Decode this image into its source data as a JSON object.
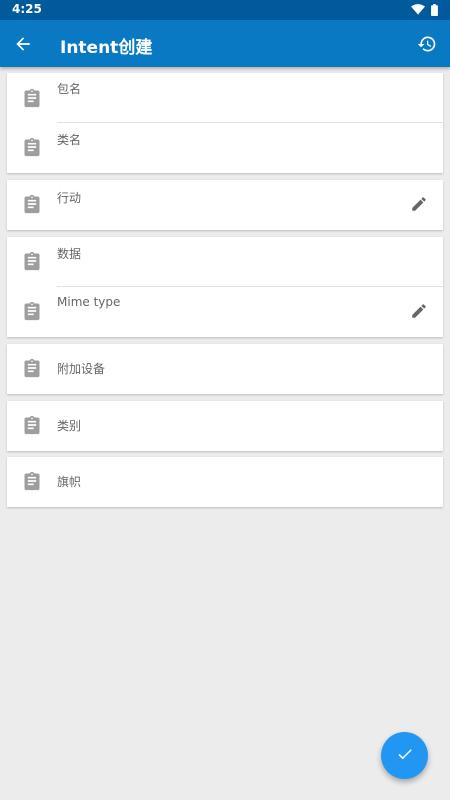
{
  "status_bar": {
    "time": "4:25",
    "icons": [
      "wifi-icon",
      "battery-icon"
    ]
  },
  "app_bar": {
    "title": "Intent创建",
    "back_icon": "arrow-back-icon",
    "history_icon": "history-icon"
  },
  "fields": {
    "package": "包名",
    "class": "类名",
    "action": "行动",
    "data": "数据",
    "mime_type": "Mime type",
    "extras": "附加设备",
    "category": "类别",
    "flags": "旗帜"
  },
  "icons": {
    "row_icon": "clipboard-icon",
    "edit_icon": "pencil-icon",
    "fab_icon": "check-icon"
  },
  "colors": {
    "status_bar": "#005a9c",
    "app_bar": "#0a79c4",
    "fab": "#2196f3",
    "background": "#ececec",
    "icon_grey": "#9e9e9e"
  }
}
